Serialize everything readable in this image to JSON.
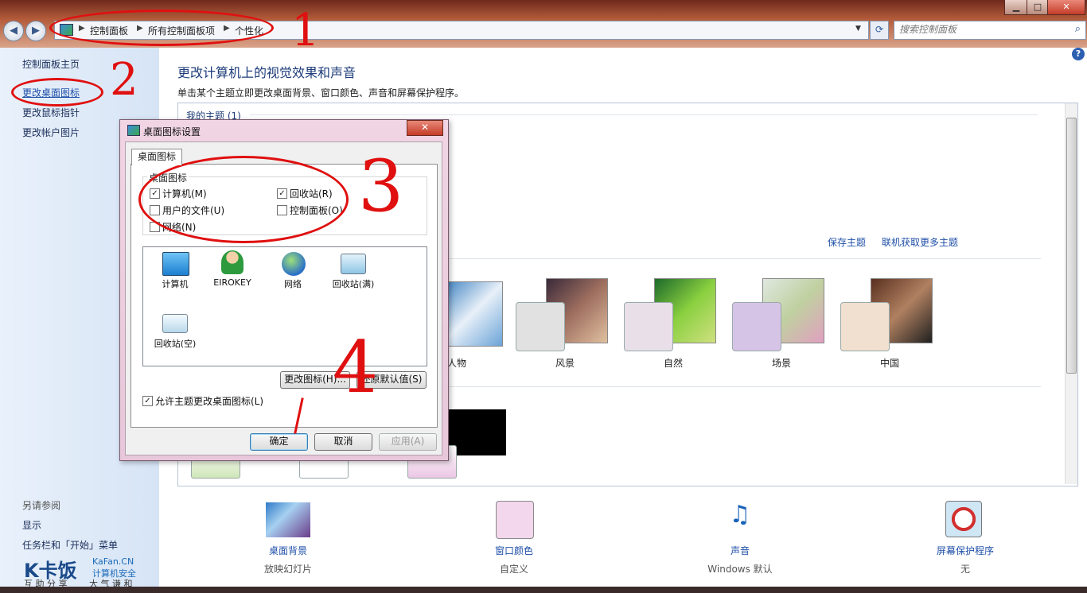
{
  "window": {
    "buttons": {
      "minimize": "▁",
      "maximize": "□",
      "close": "✕"
    },
    "nav": {
      "back": "◀",
      "forward": "▶"
    },
    "breadcrumbs": [
      "控制面板",
      "所有控制面板项",
      "个性化"
    ],
    "search_placeholder": "搜索控制面板",
    "help": "?"
  },
  "sidebar": {
    "items": [
      "控制面板主页",
      "更改桌面图标",
      "更改鼠标指针",
      "更改帐户图片"
    ],
    "see_also_title": "另请参阅",
    "see_also": [
      "显示",
      "任务栏和「开始」菜单"
    ]
  },
  "main": {
    "title": "更改计算机上的视觉效果和声音",
    "description": "单击某个主题立即更改桌面背景、窗口颜色、声音和屏幕保护程序。",
    "my_themes": "我的主题 (1)",
    "save_theme": "保存主题",
    "get_more": "联机获取更多主题",
    "themes": [
      "人物",
      "风景",
      "自然",
      "场景",
      "中国"
    ],
    "theme_colors": [
      "#cfe0ee",
      "#e1e1e1",
      "#e9dfe9",
      "#d6c4e6",
      "#f1dfcf"
    ]
  },
  "tools": [
    {
      "name": "桌面背景",
      "sub": "放映幻灯片"
    },
    {
      "name": "窗口颜色",
      "sub": "自定义"
    },
    {
      "name": "声音",
      "sub": "Windows 默认"
    },
    {
      "name": "屏幕保护程序",
      "sub": "无"
    }
  ],
  "dialog": {
    "title": "桌面图标设置",
    "close": "✕",
    "tab": "桌面图标",
    "group": "桌面图标",
    "checkboxes": [
      {
        "label": "计算机(M)",
        "checked": true
      },
      {
        "label": "回收站(R)",
        "checked": true
      },
      {
        "label": "用户的文件(U)",
        "checked": false
      },
      {
        "label": "控制面板(O)",
        "checked": false
      },
      {
        "label": "网络(N)",
        "checked": false
      }
    ],
    "icons": [
      "计算机",
      "EIROKEY",
      "网络",
      "回收站(满)",
      "回收站(空)"
    ],
    "change_icon": "更改图标(H)...",
    "restore_default": "还原默认值(S)",
    "allow_themes": "允许主题更改桌面图标(L)",
    "ok": "确定",
    "cancel": "取消",
    "apply": "应用(A)"
  },
  "annotations": [
    "1",
    "2",
    "3",
    "4"
  ],
  "watermark": {
    "brand": "K卡饭",
    "site": "KaFan.CN",
    "tag": "计算机安全",
    "sub1": "互 助 分 享",
    "sub2": "大 气 谦 和"
  }
}
